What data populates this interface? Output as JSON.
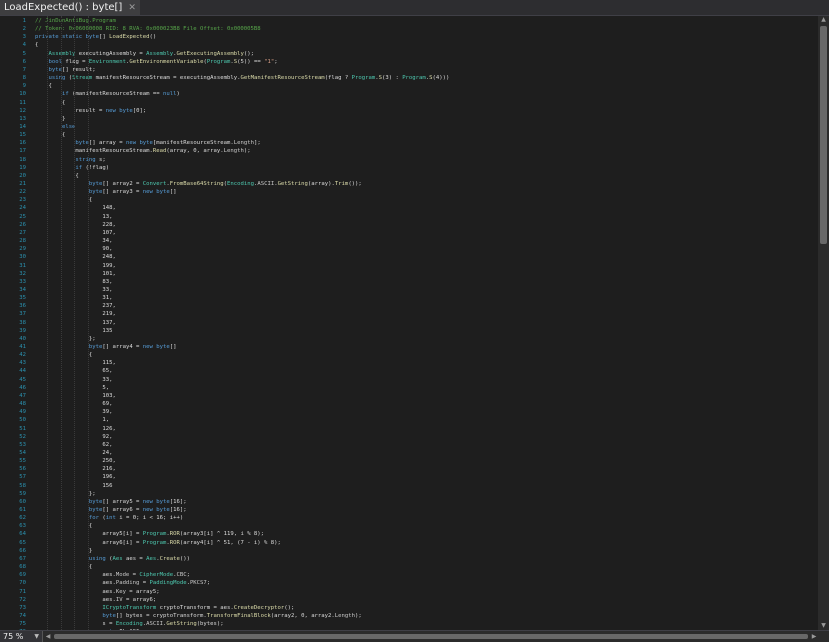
{
  "tab": {
    "title": "LoadExpected() : byte[]",
    "close_icon": "close-icon"
  },
  "zoom": {
    "value": "75 %",
    "dropdown_icon": "chevron-down-icon"
  },
  "scrollbar": {
    "up_icon": "arrow-up-icon",
    "down_icon": "arrow-down-icon",
    "left_icon": "arrow-left-icon",
    "right_icon": "arrow-right-icon"
  },
  "colors": {
    "keyword": "#569cd6",
    "type": "#4ec9b0",
    "comment": "#57a64a",
    "string": "#d69d85",
    "number": "#b5cea8",
    "method": "#dcdcaa",
    "line_number": "#2b91af",
    "background": "#1e1e1e"
  },
  "code": {
    "lines": [
      [
        [
          "// JinDunAntiBug.Program",
          "cm"
        ]
      ],
      [
        [
          "// Token: 0x06000008 RID: 8 RVA: 0x000023B8 File Offset: 0x000005B8",
          "cm"
        ]
      ],
      [
        [
          "private static ",
          "kw"
        ],
        [
          "byte",
          "kw"
        ],
        [
          "[] "
        ],
        [
          "LoadExpected",
          "me"
        ],
        [
          "()"
        ]
      ],
      [
        [
          "{"
        ]
      ],
      [
        [
          "    "
        ],
        [
          "Assembly",
          "ty"
        ],
        [
          " executingAssembly = "
        ],
        [
          "Assembly",
          "ty"
        ],
        [
          "."
        ],
        [
          "GetExecutingAssembly",
          "me"
        ],
        [
          "();"
        ]
      ],
      [
        [
          "    "
        ],
        [
          "bool",
          "kw"
        ],
        [
          " flag = "
        ],
        [
          "Environment",
          "ty"
        ],
        [
          "."
        ],
        [
          "GetEnvironmentVariable",
          "me"
        ],
        [
          "("
        ],
        [
          "Program",
          "ty"
        ],
        [
          "."
        ],
        [
          "S",
          "me"
        ],
        [
          "(5)) == "
        ],
        [
          "\"1\"",
          "st"
        ],
        [
          ";"
        ]
      ],
      [
        [
          "    "
        ],
        [
          "byte",
          "kw"
        ],
        [
          "[] result;"
        ]
      ],
      [
        [
          "    "
        ],
        [
          "using",
          "kw"
        ],
        [
          " ("
        ],
        [
          "Stream",
          "ty"
        ],
        [
          " manifestResourceStream = executingAssembly."
        ],
        [
          "GetManifestResourceStream",
          "me"
        ],
        [
          "(flag ? "
        ],
        [
          "Program",
          "ty"
        ],
        [
          "."
        ],
        [
          "S",
          "me"
        ],
        [
          "(3) : "
        ],
        [
          "Program",
          "ty"
        ],
        [
          "."
        ],
        [
          "S",
          "me"
        ],
        [
          "(4)))"
        ]
      ],
      [
        [
          "    {"
        ]
      ],
      [
        [
          "        "
        ],
        [
          "if",
          "kw"
        ],
        [
          " (manifestResourceStream == "
        ],
        [
          "null",
          "kw"
        ],
        [
          ")"
        ]
      ],
      [
        [
          "        {"
        ]
      ],
      [
        [
          "            result = "
        ],
        [
          "new",
          "kw"
        ],
        [
          " "
        ],
        [
          "byte",
          "kw"
        ],
        [
          "[0];"
        ]
      ],
      [
        [
          "        }"
        ]
      ],
      [
        [
          "        "
        ],
        [
          "else",
          "kw"
        ]
      ],
      [
        [
          "        {"
        ]
      ],
      [
        [
          "            "
        ],
        [
          "byte",
          "kw"
        ],
        [
          "[] array = "
        ],
        [
          "new",
          "kw"
        ],
        [
          " "
        ],
        [
          "byte",
          "kw"
        ],
        [
          "[manifestResourceStream."
        ],
        [
          "Length",
          "fi"
        ],
        [
          "];"
        ]
      ],
      [
        [
          "            manifestResourceStream."
        ],
        [
          "Read",
          "me"
        ],
        [
          "(array, 0, array."
        ],
        [
          "Length",
          "fi"
        ],
        [
          ");"
        ]
      ],
      [
        [
          "            "
        ],
        [
          "string",
          "kw"
        ],
        [
          " s;"
        ]
      ],
      [
        [
          "            "
        ],
        [
          "if",
          "kw"
        ],
        [
          " (!flag)"
        ]
      ],
      [
        [
          "            {"
        ]
      ],
      [
        [
          "                "
        ],
        [
          "byte",
          "kw"
        ],
        [
          "[] array2 = "
        ],
        [
          "Convert",
          "ty"
        ],
        [
          "."
        ],
        [
          "FromBase64String",
          "me"
        ],
        [
          "("
        ],
        [
          "Encoding",
          "ty"
        ],
        [
          "."
        ],
        [
          "ASCII",
          "fi"
        ],
        [
          "."
        ],
        [
          "GetString",
          "me"
        ],
        [
          "(array)."
        ],
        [
          "Trim",
          "me"
        ],
        [
          "());"
        ]
      ],
      [
        [
          "                "
        ],
        [
          "byte",
          "kw"
        ],
        [
          "[] array3 = "
        ],
        [
          "new",
          "kw"
        ],
        [
          " "
        ],
        [
          "byte",
          "kw"
        ],
        [
          "[]"
        ]
      ],
      [
        [
          "                {"
        ]
      ],
      [
        [
          "                    148,"
        ]
      ],
      [
        [
          "                    13,"
        ]
      ],
      [
        [
          "                    228,"
        ]
      ],
      [
        [
          "                    107,"
        ]
      ],
      [
        [
          "                    34,"
        ]
      ],
      [
        [
          "                    90,"
        ]
      ],
      [
        [
          "                    248,"
        ]
      ],
      [
        [
          "                    199,"
        ]
      ],
      [
        [
          "                    101,"
        ]
      ],
      [
        [
          "                    83,"
        ]
      ],
      [
        [
          "                    33,"
        ]
      ],
      [
        [
          "                    31,"
        ]
      ],
      [
        [
          "                    237,"
        ]
      ],
      [
        [
          "                    219,"
        ]
      ],
      [
        [
          "                    137,"
        ]
      ],
      [
        [
          "                    135"
        ]
      ],
      [
        [
          "                };"
        ]
      ],
      [
        [
          "                "
        ],
        [
          "byte",
          "kw"
        ],
        [
          "[] array4 = "
        ],
        [
          "new",
          "kw"
        ],
        [
          " "
        ],
        [
          "byte",
          "kw"
        ],
        [
          "[]"
        ]
      ],
      [
        [
          "                {"
        ]
      ],
      [
        [
          "                    115,"
        ]
      ],
      [
        [
          "                    65,"
        ]
      ],
      [
        [
          "                    33,"
        ]
      ],
      [
        [
          "                    5,"
        ]
      ],
      [
        [
          "                    103,"
        ]
      ],
      [
        [
          "                    69,"
        ]
      ],
      [
        [
          "                    39,"
        ]
      ],
      [
        [
          "                    1,"
        ]
      ],
      [
        [
          "                    126,"
        ]
      ],
      [
        [
          "                    92,"
        ]
      ],
      [
        [
          "                    62,"
        ]
      ],
      [
        [
          "                    24,"
        ]
      ],
      [
        [
          "                    250,"
        ]
      ],
      [
        [
          "                    216,"
        ]
      ],
      [
        [
          "                    196,"
        ]
      ],
      [
        [
          "                    156"
        ]
      ],
      [
        [
          "                };"
        ]
      ],
      [
        [
          "                "
        ],
        [
          "byte",
          "kw"
        ],
        [
          "[] array5 = "
        ],
        [
          "new",
          "kw"
        ],
        [
          " "
        ],
        [
          "byte",
          "kw"
        ],
        [
          "[16];"
        ]
      ],
      [
        [
          "                "
        ],
        [
          "byte",
          "kw"
        ],
        [
          "[] array6 = "
        ],
        [
          "new",
          "kw"
        ],
        [
          " "
        ],
        [
          "byte",
          "kw"
        ],
        [
          "[16];"
        ]
      ],
      [
        [
          "                "
        ],
        [
          "for",
          "kw"
        ],
        [
          " ("
        ],
        [
          "int",
          "kw"
        ],
        [
          " i = 0; i < 16; i++)"
        ]
      ],
      [
        [
          "                {"
        ]
      ],
      [
        [
          "                    array5[i] = "
        ],
        [
          "Program",
          "ty"
        ],
        [
          "."
        ],
        [
          "ROR",
          "me"
        ],
        [
          "(array3[i] ^ 119, i % 8);"
        ]
      ],
      [
        [
          "                    array6[i] = "
        ],
        [
          "Program",
          "ty"
        ],
        [
          "."
        ],
        [
          "ROR",
          "me"
        ],
        [
          "(array4[i] ^ 51, (7 - i) % 8);"
        ]
      ],
      [
        [
          "                }"
        ]
      ],
      [
        [
          "                "
        ],
        [
          "using",
          "kw"
        ],
        [
          " ("
        ],
        [
          "Aes",
          "ty"
        ],
        [
          " aes = "
        ],
        [
          "Aes",
          "ty"
        ],
        [
          "."
        ],
        [
          "Create",
          "me"
        ],
        [
          "())"
        ]
      ],
      [
        [
          "                {"
        ]
      ],
      [
        [
          "                    aes."
        ],
        [
          "Mode",
          "fi"
        ],
        [
          " = "
        ],
        [
          "CipherMode",
          "ty"
        ],
        [
          "."
        ],
        [
          "CBC",
          "fi"
        ],
        [
          ";"
        ]
      ],
      [
        [
          "                    aes."
        ],
        [
          "Padding",
          "fi"
        ],
        [
          " = "
        ],
        [
          "PaddingMode",
          "ty"
        ],
        [
          "."
        ],
        [
          "PKCS7",
          "fi"
        ],
        [
          ";"
        ]
      ],
      [
        [
          "                    aes."
        ],
        [
          "Key",
          "fi"
        ],
        [
          " = array5;"
        ]
      ],
      [
        [
          "                    aes."
        ],
        [
          "IV",
          "fi"
        ],
        [
          " = array6;"
        ]
      ],
      [
        [
          "                    "
        ],
        [
          "ICryptoTransform",
          "ty"
        ],
        [
          " cryptoTransform = aes."
        ],
        [
          "CreateDecryptor",
          "me"
        ],
        [
          "();"
        ]
      ],
      [
        [
          "                    "
        ],
        [
          "byte",
          "kw"
        ],
        [
          "[] bytes = cryptoTransform."
        ],
        [
          "TransformFinalBlock",
          "me"
        ],
        [
          "(array2, 0, array2."
        ],
        [
          "Length",
          "fi"
        ],
        [
          ");"
        ]
      ],
      [
        [
          "                    s = "
        ],
        [
          "Encoding",
          "ty"
        ],
        [
          "."
        ],
        [
          "ASCII",
          "fi"
        ],
        [
          "."
        ],
        [
          "GetString",
          "me"
        ],
        [
          "(bytes);"
        ]
      ],
      [
        [
          "                    "
        ],
        [
          "goto",
          "kw"
        ],
        [
          " IL_196;"
        ]
      ]
    ]
  }
}
